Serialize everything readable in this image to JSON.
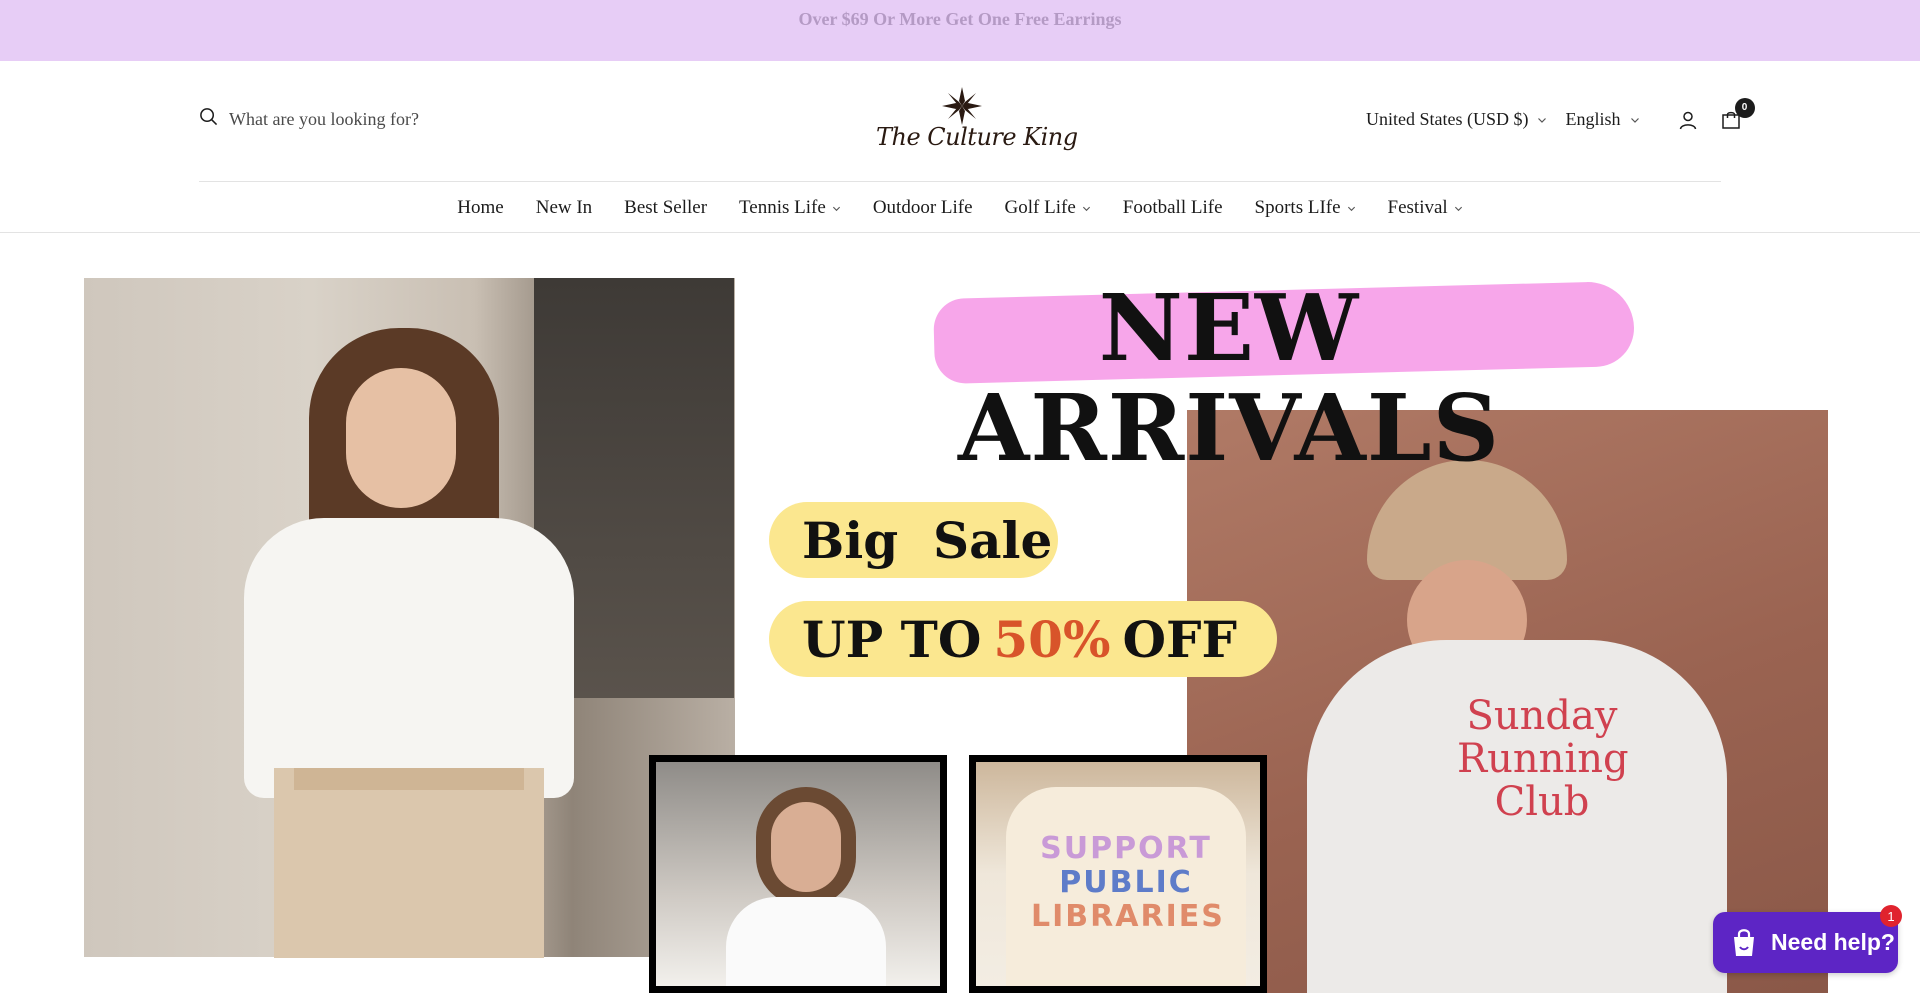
{
  "announcement": {
    "text": "Over $69 Or More Get One Free Earrings"
  },
  "header": {
    "search": {
      "placeholder": "What are you looking for?"
    },
    "logo": {
      "text": "The Culture King"
    },
    "currency": {
      "label": "United States (USD $)"
    },
    "language": {
      "label": "English"
    },
    "cart": {
      "count": "0"
    }
  },
  "nav": {
    "items": [
      {
        "label": "Home",
        "has_dropdown": false
      },
      {
        "label": "New In",
        "has_dropdown": false
      },
      {
        "label": "Best Seller",
        "has_dropdown": false
      },
      {
        "label": "Tennis Life",
        "has_dropdown": true
      },
      {
        "label": "Outdoor Life",
        "has_dropdown": false
      },
      {
        "label": "Golf Life",
        "has_dropdown": true
      },
      {
        "label": "Football Life",
        "has_dropdown": false
      },
      {
        "label": "Sports LIfe",
        "has_dropdown": true
      },
      {
        "label": "Festival",
        "has_dropdown": true
      }
    ]
  },
  "hero": {
    "headline": "NEW ARRIVALS",
    "sale_line_1": "Big  Sale",
    "sale_line_2_prefix": "UP TO",
    "sale_line_2_highlight": "50%",
    "sale_line_2_suffix": "OFF",
    "sweatshirt_text": [
      "Sunday",
      "Running",
      "Club"
    ],
    "tee_text": [
      "SUPPORT",
      "PUBLIC",
      "LIBRARIES"
    ]
  },
  "chat": {
    "label": "Need help?",
    "badge": "1"
  },
  "colors": {
    "announcement_bg": "#e7cdf6",
    "announcement_text": "#b49ac4",
    "headline_highlight": "#f7a6ea",
    "sale_pill": "#fbe78f",
    "sale_accent": "#d8542a",
    "chat_bg": "#5d25c5",
    "chat_badge": "#e0232e"
  },
  "icons": {
    "search": "search-icon",
    "account": "user-icon",
    "cart": "cart-icon",
    "chevron": "chevron-down-icon",
    "chat": "shopify-bag-icon"
  }
}
